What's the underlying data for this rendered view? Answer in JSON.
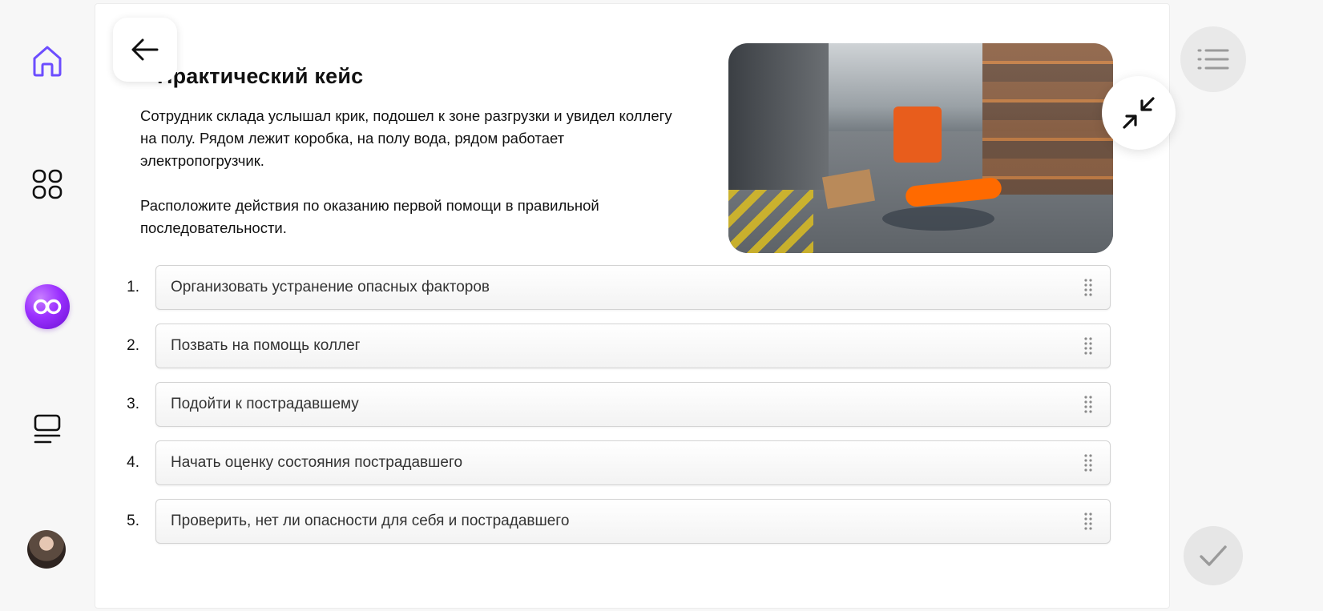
{
  "sidebar": {
    "items": [
      {
        "name": "home",
        "icon": "home-icon"
      },
      {
        "name": "apps",
        "icon": "apps-grid-icon"
      },
      {
        "name": "ai-assistant",
        "icon": "infinity-orb-icon"
      },
      {
        "name": "courses",
        "icon": "courses-icon"
      },
      {
        "name": "profile",
        "icon": "avatar"
      }
    ],
    "accent_color": "#6c4dff",
    "ai_color": "#9b30ff"
  },
  "case": {
    "title": "Практический кейс",
    "description": "Сотрудник склада услышал крик, подошел к зоне разгрузки и увидел коллегу на полу. Рядом лежит коробка, на полу вода, рядом работает электропогрузчик.",
    "instruction": "Расположите действия по оказанию первой помощи в правильной последовательности."
  },
  "steps": [
    {
      "number": "1.",
      "label": "Организовать устранение опасных факторов"
    },
    {
      "number": "2.",
      "label": "Позвать на помощь коллег"
    },
    {
      "number": "3.",
      "label": "Подойти к пострадавшему"
    },
    {
      "number": "4.",
      "label": "Начать оценку состояния пострадавшего"
    },
    {
      "number": "5.",
      "label": "Проверить, нет ли опасности для себя и пострадавшего"
    }
  ],
  "controls": {
    "back_icon": "arrow-left-icon",
    "shrink_icon": "collapse-icon",
    "menu_icon": "list-icon",
    "submit_icon": "checkmark-icon",
    "drag_icon": "drag-handle-icon"
  }
}
